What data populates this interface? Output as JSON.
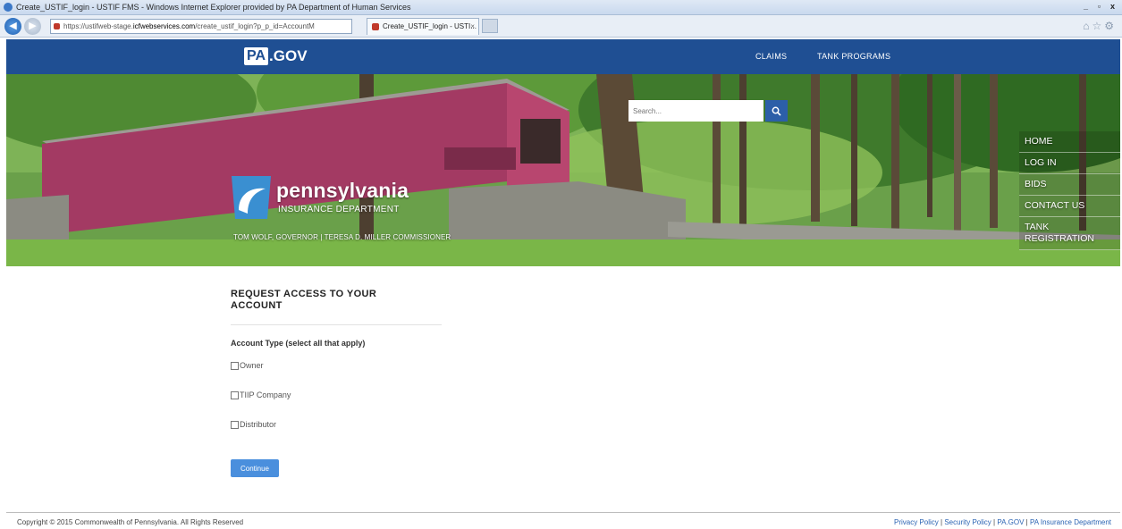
{
  "browser": {
    "window_title": "Create_USTIF_login - USTIF FMS - Windows Internet Explorer provided by PA Department of Human Services",
    "url_prefix": "https://ustifweb-stage.",
    "url_host": "icfwebservices.com",
    "url_path": "/create_ustif_login?p_p_id=AccountM",
    "tab_title": "Create_USTIF_login - USTI...",
    "tab_close": "×",
    "win_min": "_",
    "win_max": "▫",
    "win_close": "x",
    "icons": [
      "home-icon",
      "star-icon",
      "gear-icon"
    ]
  },
  "header": {
    "logo_pa": "PA",
    "logo_gov": ".GOV",
    "nav": [
      "CLAIMS",
      "TANK PROGRAMS"
    ],
    "brand_color": "#1f4f93"
  },
  "hero": {
    "search_placeholder": "Search...",
    "brand_name": "pennsylvania",
    "brand_sub": "INSURANCE DEPARTMENT",
    "governor_line": "TOM WOLF, GOVERNOR  |  TERESA D. MILLER COMMISSIONER",
    "side_menu": [
      "HOME",
      "LOG IN",
      "BIDS",
      "CONTACT US",
      "TANK REGISTRATION"
    ]
  },
  "form": {
    "title": "REQUEST ACCESS TO YOUR ACCOUNT",
    "account_type_label": "Account Type (select all that apply)",
    "options": [
      "Owner",
      "TIIP Company",
      "Distributor"
    ],
    "continue_label": "Continue",
    "accent": "#4a8fdd"
  },
  "footer": {
    "copyright": "Copyright © 2015 Commonwealth of Pennsylvania. All Rights Reserved",
    "links": [
      "Privacy Policy",
      "Security Policy",
      "PA.GOV",
      "PA Insurance Department"
    ],
    "separator": "|"
  }
}
